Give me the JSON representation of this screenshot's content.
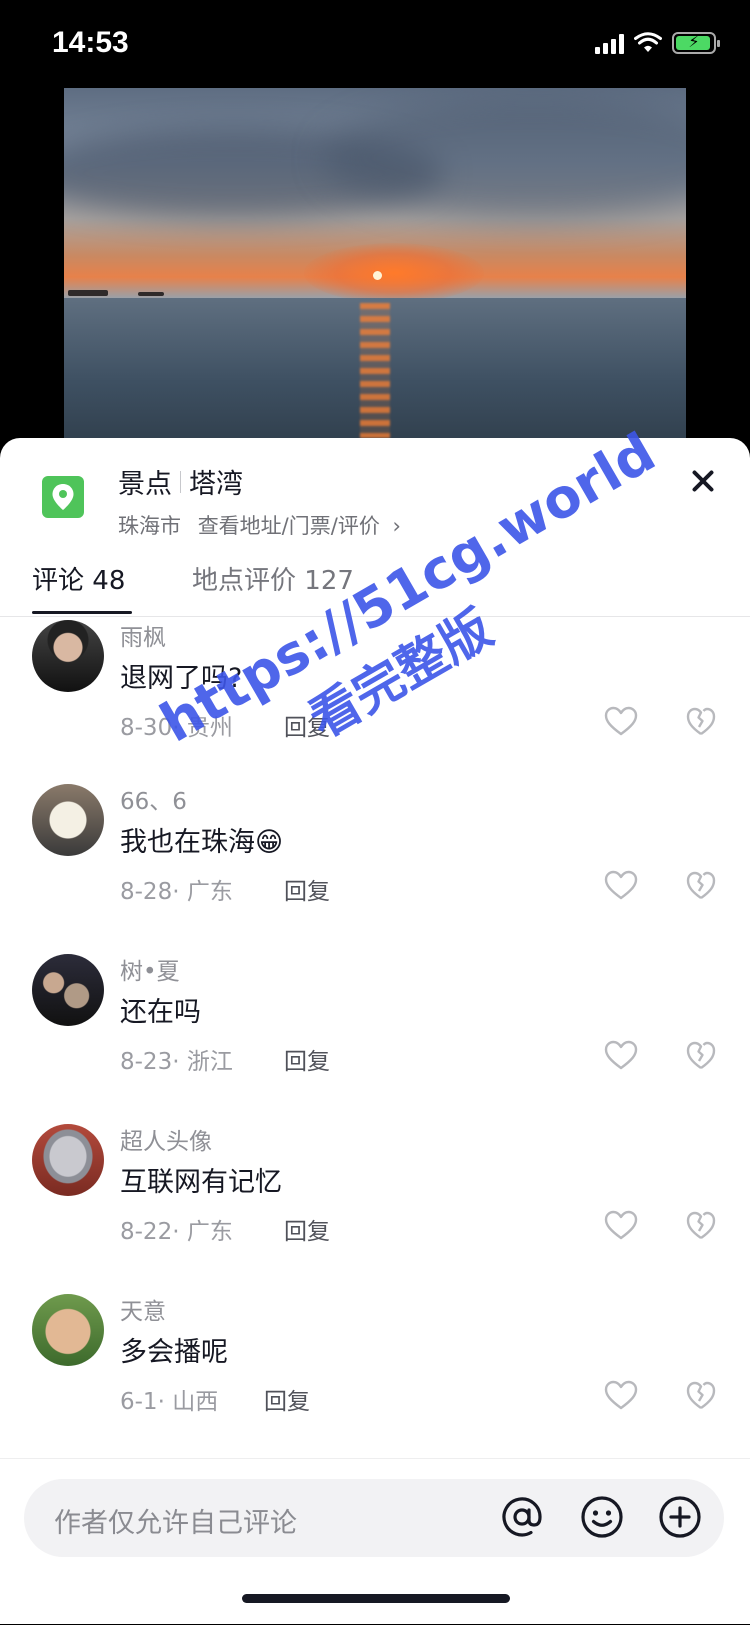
{
  "status_bar": {
    "time": "14:53"
  },
  "location": {
    "category": "景点",
    "name": "塔湾",
    "city": "珠海市",
    "link_text": "查看地址/门票/评价",
    "chevron": "›",
    "icon": "location-pin-icon",
    "icon_color": "#4fc45a"
  },
  "tabs": [
    {
      "label": "评论",
      "count": "48"
    },
    {
      "label": "地点评价",
      "count": "127"
    }
  ],
  "comments": [
    {
      "name": "雨枫",
      "text": "退网了吗?",
      "date": "8-30",
      "region": "贵州",
      "reply": "回复"
    },
    {
      "name": "66、6",
      "text": "我也在珠海😁",
      "date": "8-28",
      "region": "广东",
      "reply": "回复"
    },
    {
      "name": "树•夏",
      "text": "还在吗",
      "date": "8-23",
      "region": "浙江",
      "reply": "回复"
    },
    {
      "name": "超人头像",
      "text": "互联网有记忆",
      "date": "8-22",
      "region": "广东",
      "reply": "回复"
    },
    {
      "name": "天意",
      "text": "多会播呢",
      "date": "6-1",
      "region": "山西",
      "reply": "回复"
    }
  ],
  "input": {
    "placeholder": "作者仅允许自己评论"
  },
  "watermark": {
    "url": "https://51cg.world",
    "text": "看完整版"
  }
}
